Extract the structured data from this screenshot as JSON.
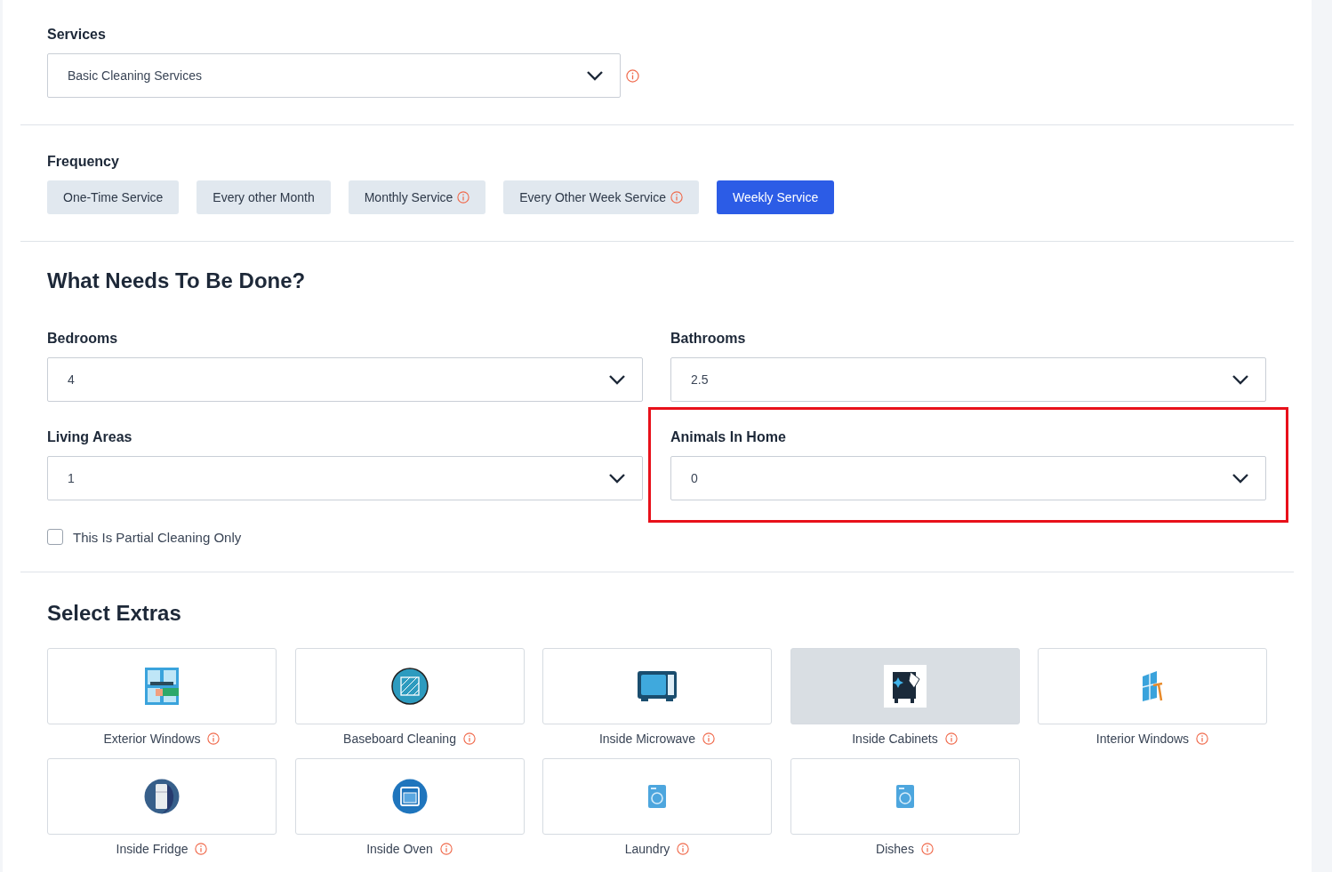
{
  "services": {
    "label": "Services",
    "value": "Basic Cleaning Services",
    "info": true
  },
  "frequency": {
    "label": "Frequency",
    "options": [
      {
        "label": "One-Time Service",
        "info": false,
        "selected": false
      },
      {
        "label": "Every other Month",
        "info": false,
        "selected": false
      },
      {
        "label": "Monthly Service",
        "info": true,
        "selected": false
      },
      {
        "label": "Every Other Week Service",
        "info": true,
        "selected": false
      },
      {
        "label": "Weekly Service",
        "info": false,
        "selected": true
      }
    ]
  },
  "needs": {
    "title": "What Needs To Be Done?",
    "fields": [
      {
        "label": "Bedrooms",
        "value": "4",
        "highlighted": false
      },
      {
        "label": "Bathrooms",
        "value": "2.5",
        "highlighted": false
      },
      {
        "label": "Living Areas",
        "value": "1",
        "highlighted": false
      },
      {
        "label": "Animals In Home",
        "value": "0",
        "highlighted": true
      }
    ],
    "partial": {
      "label": "This Is Partial Cleaning Only",
      "checked": false
    }
  },
  "extras": {
    "title": "Select Extras",
    "items": [
      {
        "label": "Exterior Windows",
        "kind": "window-squeegee",
        "selected": false
      },
      {
        "label": "Baseboard Cleaning",
        "kind": "floor",
        "selected": false
      },
      {
        "label": "Inside Microwave",
        "kind": "microwave",
        "selected": false
      },
      {
        "label": "Inside Cabinets",
        "kind": "cabinet",
        "selected": true
      },
      {
        "label": "Interior Windows",
        "kind": "window",
        "selected": false
      },
      {
        "label": "Inside Fridge",
        "kind": "fridge",
        "selected": false
      },
      {
        "label": "Inside Oven",
        "kind": "oven",
        "selected": false
      },
      {
        "label": "Laundry",
        "kind": "washer",
        "selected": false
      },
      {
        "label": "Dishes",
        "kind": "washer",
        "selected": false
      }
    ]
  }
}
